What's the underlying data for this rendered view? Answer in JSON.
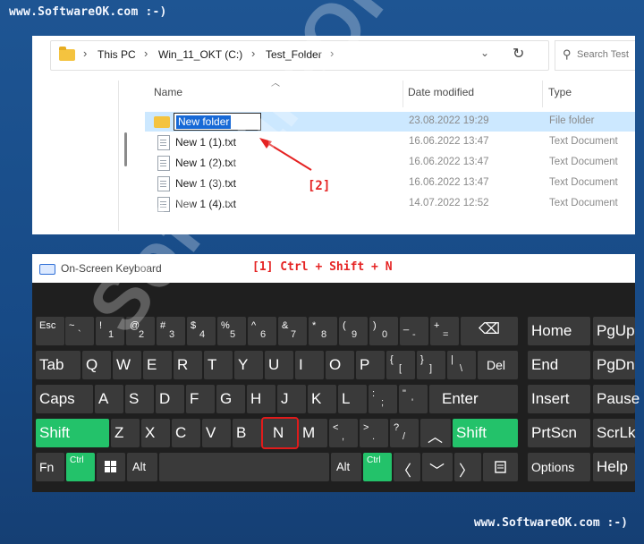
{
  "watermark": {
    "top": "www.SoftwareOK.com :-)",
    "bottom": "www.SoftwareOK.com :-)",
    "big": "SoftwareOK.com"
  },
  "explorer": {
    "breadcrumb": [
      "This PC",
      "Win_11_OKT (C:)",
      "Test_Folder"
    ],
    "search_placeholder": "Search Test",
    "columns": {
      "name": "Name",
      "date": "Date modified",
      "type": "Type"
    },
    "rows": [
      {
        "name": "New folder",
        "date": "23.08.2022 19:29",
        "type": "File folder",
        "selected": true,
        "kind": "folder"
      },
      {
        "name": "New 1 (1).txt",
        "date": "16.06.2022 13:47",
        "type": "Text Document",
        "kind": "txt"
      },
      {
        "name": "New 1 (2).txt",
        "date": "16.06.2022 13:47",
        "type": "Text Document",
        "kind": "txt"
      },
      {
        "name": "New 1 (3).txt",
        "date": "16.06.2022 13:47",
        "type": "Text Document",
        "kind": "txt"
      },
      {
        "name": "New 1 (4).txt",
        "date": "14.07.2022 12:52",
        "type": "Text Document",
        "kind": "txt"
      }
    ],
    "annotation": "[2]"
  },
  "osk": {
    "title": "On-Screen Keyboard",
    "shortcut_annotation": "[1] Ctrl + Shift + N",
    "keys": {
      "esc": "Esc",
      "tilde": "~",
      "tick": "`",
      "n1t": "!",
      "n1": "1",
      "n2t": "@",
      "n2": "2",
      "n3t": "#",
      "n3": "3",
      "n4t": "$",
      "n4": "4",
      "n5t": "%",
      "n5": "5",
      "n6t": "^",
      "n6": "6",
      "n7t": "&",
      "n7": "7",
      "n8t": "*",
      "n8": "8",
      "n9t": "(",
      "n9": "9",
      "n0t": ")",
      "n0": "0",
      "minust": "_",
      "minus": "-",
      "plust": "+",
      "plus": "=",
      "backspace": "⌫",
      "tab": "Tab",
      "q": "Q",
      "w": "W",
      "e": "E",
      "r": "R",
      "t": "T",
      "y": "Y",
      "u": "U",
      "i": "I",
      "o": "O",
      "p": "P",
      "lbrt": "{",
      "lbr": "[",
      "rbrt": "}",
      "rbr": "]",
      "pipet": "|",
      "pipe": "\\",
      "del": "Del",
      "caps": "Caps",
      "a": "A",
      "s": "S",
      "d": "D",
      "f": "F",
      "g": "G",
      "h": "H",
      "j": "J",
      "k": "K",
      "l": "L",
      "colont": ":",
      "colon": ";",
      "quotet": "\"",
      "quote": "'",
      "enter": "Enter",
      "shift": "Shift",
      "z": "Z",
      "x": "X",
      "c": "C",
      "v": "V",
      "b": "B",
      "n": "N",
      "m": "M",
      "lt": "<",
      "comma": ",",
      "gt": ">",
      "period": ".",
      "qmt": "?",
      "slash": "/",
      "up": "︿",
      "shift_r": "Shift",
      "fn": "Fn",
      "ctrl": "Ctrl",
      "alt": "Alt",
      "altgr": "Alt",
      "ctrl_r": "Ctrl",
      "left": "〈",
      "down": "﹀",
      "right": "〉",
      "home": "Home",
      "pgup": "PgUp",
      "end": "End",
      "pgdn": "PgDn",
      "insert": "Insert",
      "pause": "Pause",
      "prtscn": "PrtScn",
      "scrlk": "ScrLk",
      "options": "Options",
      "help": "Help"
    }
  }
}
